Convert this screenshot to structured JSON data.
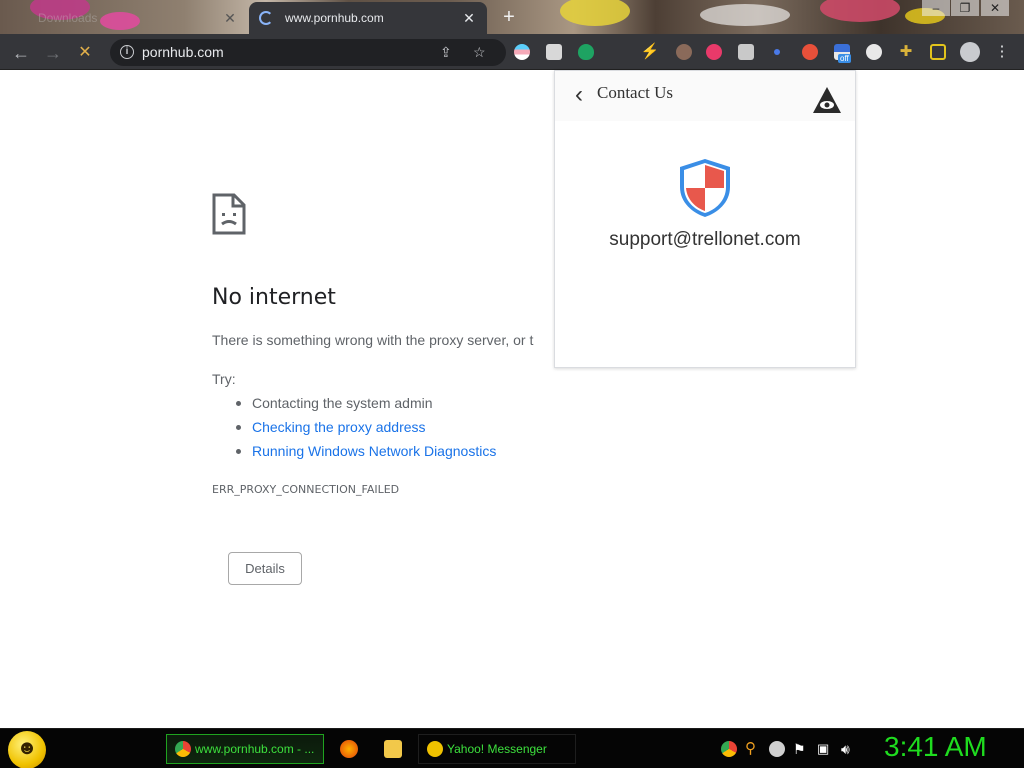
{
  "browser": {
    "tabs": [
      {
        "label": "Downloads",
        "active": false
      },
      {
        "label": "www.pornhub.com",
        "active": true,
        "loading": true
      }
    ],
    "window_controls": [
      "minimize",
      "restore",
      "close"
    ],
    "omnibox": {
      "url": "pornhub.com"
    },
    "nav": {
      "back": "←",
      "forward": "→",
      "stop": "✕"
    },
    "extensions": [
      "pride-extension-icon",
      "puzzle-image-icon",
      "adblock-shield-icon",
      "bolt-icon",
      "avatar-extension-icon",
      "vpn-globe-icon",
      "checkbox-extension-icon",
      "dot-icon",
      "red-circle-icon",
      "flag-off-extension-icon",
      "rocket-icon",
      "puzzle-icon",
      "sidebar-icon",
      "profile-icon",
      "menu-icon"
    ],
    "vpn_badge": "off"
  },
  "error": {
    "title": "No internet",
    "description": "There is something wrong with the proxy server, or t",
    "try_label": "Try:",
    "suggestions": [
      {
        "text": "Contacting the system admin",
        "link": false
      },
      {
        "text": "Checking the proxy address",
        "link": true
      },
      {
        "text": "Running Windows Network Diagnostics",
        "link": true
      }
    ],
    "code": "ERR_PROXY_CONNECTION_FAILED",
    "details_label": "Details"
  },
  "popup": {
    "title": "Contact Us",
    "email": "support@trellonet.com"
  },
  "taskbar": {
    "tasks": [
      {
        "label": "www.pornhub.com - ...",
        "active": true
      },
      {
        "label": "Yahoo! Messenger",
        "active": false
      }
    ],
    "clock": "3:41 AM"
  },
  "colors": {
    "link": "#1a73e8",
    "clock": "#1fdc1f",
    "shield_red": "#e8584c",
    "shield_blue": "#3a8ee6"
  }
}
